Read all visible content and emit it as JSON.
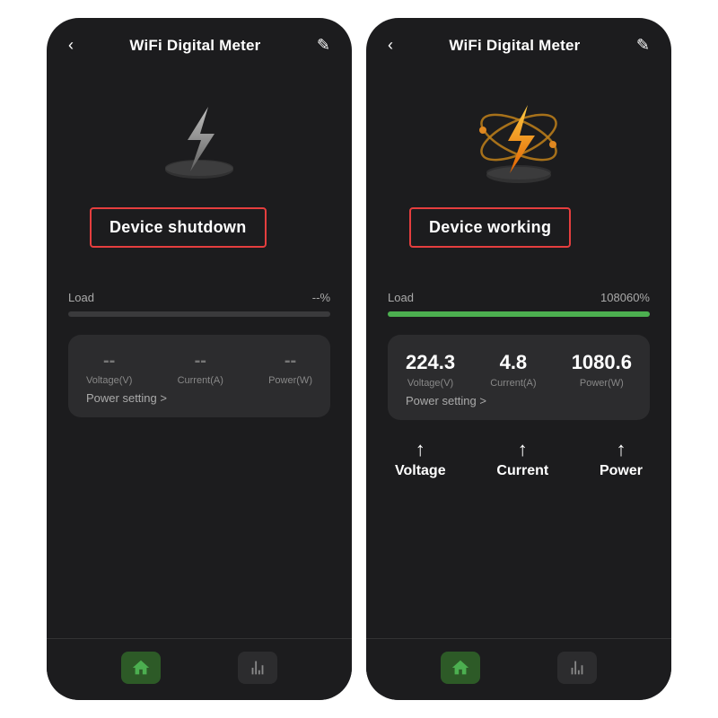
{
  "left_panel": {
    "header": {
      "title": "WiFi Digital Meter",
      "back_icon": "‹",
      "edit_icon": "✎"
    },
    "status": "Device shutdown",
    "load_label": "Load",
    "load_value": "--%",
    "load_percent": 0,
    "metrics": {
      "voltage": {
        "value": "--",
        "label": "Voltage(V)"
      },
      "current": {
        "value": "--",
        "label": "Current(A)"
      },
      "power": {
        "value": "--",
        "label": "Power(W)"
      }
    },
    "power_setting": "Power setting >",
    "nav": {
      "home_label": "home",
      "chart_label": "chart"
    }
  },
  "right_panel": {
    "header": {
      "title": "WiFi Digital Meter",
      "back_icon": "‹",
      "edit_icon": "✎"
    },
    "status": "Device working",
    "load_label": "Load",
    "load_value": "108060%",
    "load_percent": 100,
    "metrics": {
      "voltage": {
        "value": "224.3",
        "label": "Voltage(V)"
      },
      "current": {
        "value": "4.8",
        "label": "Current(A)"
      },
      "power": {
        "value": "1080.6",
        "label": "Power(W)"
      }
    },
    "power_setting": "Power setting >",
    "annotations": {
      "voltage": "Voltage",
      "current": "Current",
      "power": "Power"
    },
    "nav": {
      "home_label": "home",
      "chart_label": "chart"
    }
  },
  "colors": {
    "accent_red": "#e53e3e",
    "progress_green": "#4caf50",
    "bg_dark": "#1c1c1e",
    "card_bg": "#2c2c2e"
  }
}
